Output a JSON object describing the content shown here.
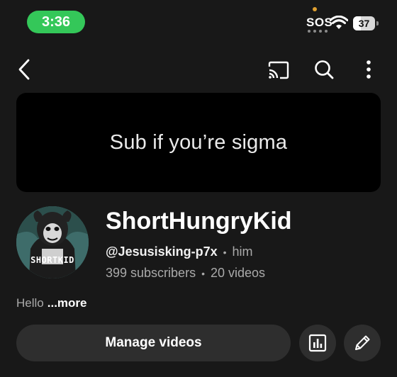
{
  "status_bar": {
    "time": "3:36",
    "sos": "SOS",
    "battery": "37",
    "battery_level": 0.37
  },
  "top_bar": {
    "icons": [
      "back-icon",
      "cast-icon",
      "search-icon",
      "more-vert-icon"
    ]
  },
  "banner": {
    "text": "Sub if you’re sigma"
  },
  "channel": {
    "avatar_text": "SHORTKID",
    "name": "ShortHungryKid",
    "handle": "@Jesusisking-p7x",
    "separator": "•",
    "pronouns": "him",
    "subscribers": "399 subscribers",
    "videos": "20 videos",
    "description": "Hello",
    "more_label": "...more"
  },
  "actions": {
    "manage_label": "Manage videos",
    "analytics_icon": "analytics-icon",
    "edit_icon": "pencil-icon"
  },
  "colors": {
    "background": "#181818",
    "time_pill": "#34c759",
    "button_bg": "#2e2e2e",
    "banner_bg": "#000000",
    "secondary_text": "#aaaaaa"
  }
}
